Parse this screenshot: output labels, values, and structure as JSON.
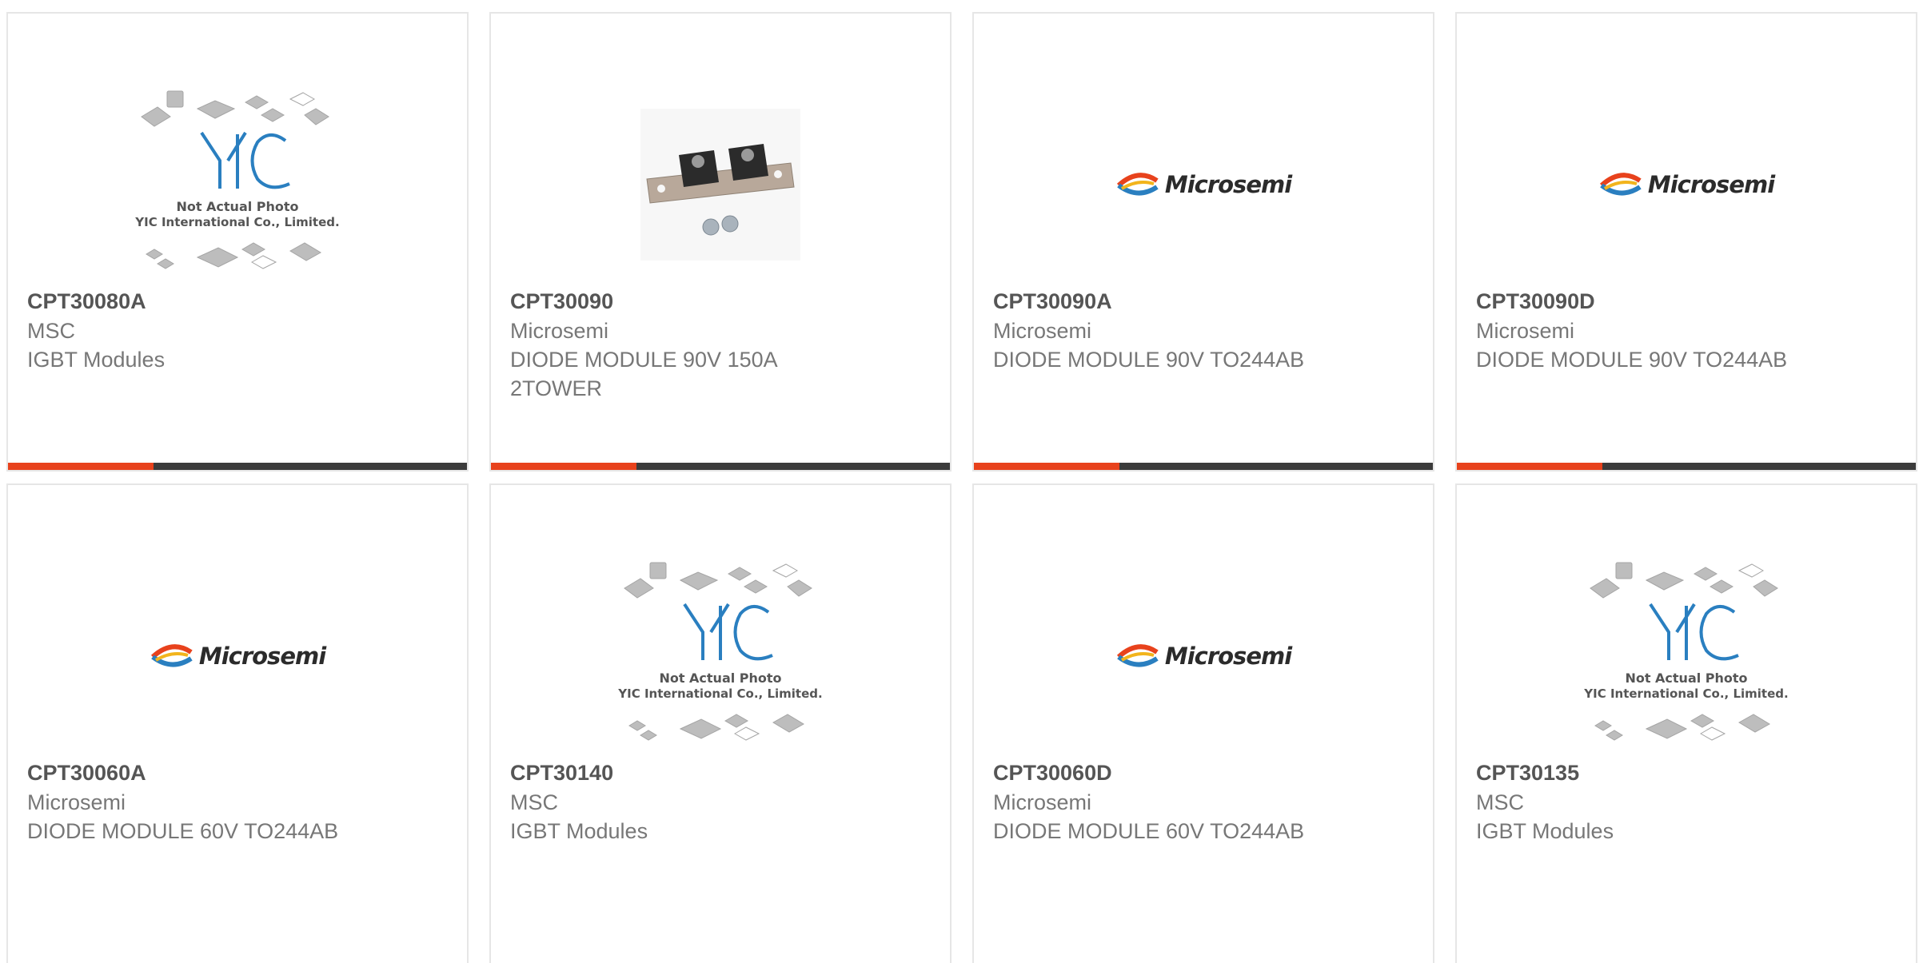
{
  "products": [
    {
      "part_number": "CPT30080A",
      "manufacturer": "MSC",
      "description": "IGBT Modules",
      "image_type": "yic-placeholder",
      "image_caption": [
        "Not Actual Photo",
        "YIC International Co., Limited."
      ]
    },
    {
      "part_number": "CPT30090",
      "manufacturer": "Microsemi",
      "description": "DIODE MODULE 90V 150A 2TOWER",
      "image_type": "diode-module-photo"
    },
    {
      "part_number": "CPT30090A",
      "manufacturer": "Microsemi",
      "description": "DIODE MODULE 90V TO244AB",
      "image_type": "microsemi-logo",
      "logo_text": "Microsemi"
    },
    {
      "part_number": "CPT30090D",
      "manufacturer": "Microsemi",
      "description": "DIODE MODULE 90V TO244AB",
      "image_type": "microsemi-logo",
      "logo_text": "Microsemi"
    },
    {
      "part_number": "CPT30060A",
      "manufacturer": "Microsemi",
      "description": "DIODE MODULE 60V TO244AB",
      "image_type": "microsemi-logo",
      "logo_text": "Microsemi"
    },
    {
      "part_number": "CPT30140",
      "manufacturer": "MSC",
      "description": "IGBT Modules",
      "image_type": "yic-placeholder",
      "image_caption": [
        "Not Actual Photo",
        "YIC International Co., Limited."
      ]
    },
    {
      "part_number": "CPT30060D",
      "manufacturer": "Microsemi",
      "description": "DIODE MODULE 60V TO244AB",
      "image_type": "microsemi-logo",
      "logo_text": "Microsemi"
    },
    {
      "part_number": "CPT30135",
      "manufacturer": "MSC",
      "description": "IGBT Modules",
      "image_type": "yic-placeholder",
      "image_caption": [
        "Not Actual Photo",
        "YIC International Co., Limited."
      ]
    }
  ],
  "colors": {
    "accent_bar": "#e8421c",
    "dark_bar": "#3b3b3b",
    "card_border": "#e6e6e6",
    "part_number_text": "#555555",
    "secondary_text": "#777777",
    "yic_logo_blue": "#2a7fc0"
  }
}
